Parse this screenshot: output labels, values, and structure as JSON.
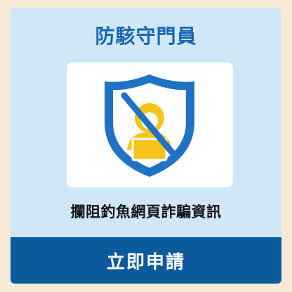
{
  "card": {
    "title": "防駭守門員",
    "description": "攔阻釣魚網頁詐騙資訊",
    "apply_label": "立即申請",
    "icon": "shield-blocked-hacker-icon"
  },
  "colors": {
    "background": "#f6e9d6",
    "card": "#cfe7f6",
    "title": "#1766b0",
    "button": "#0a5a9c",
    "shield": "#1f72c4",
    "hacker": "#f4c418"
  }
}
